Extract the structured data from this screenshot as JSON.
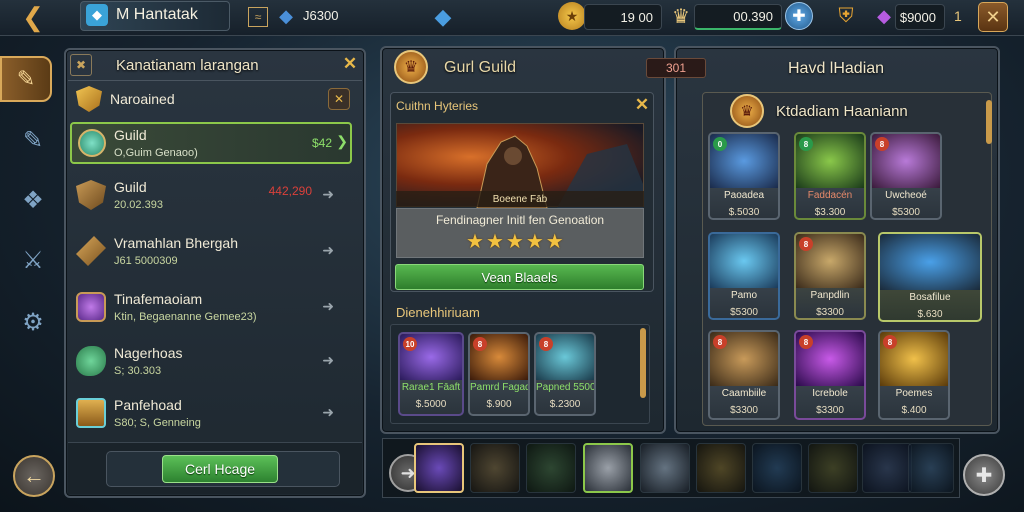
{
  "topbar": {
    "player_name": "M Hantatak",
    "currency1": "J6300",
    "res_gold": "19 00",
    "res_blue": "00.390",
    "res_gems": "$9000",
    "res_gems_suffix": "1"
  },
  "left_panel": {
    "title": "Kanatianam larangan",
    "items": [
      {
        "title": "Naroained",
        "sub": "",
        "value": "",
        "icon": "shield-icon"
      },
      {
        "title": "Guild",
        "sub": "O,Guim Genaoo)",
        "value": "$42",
        "icon": "guild-emblem-icon"
      },
      {
        "title": "Guild",
        "sub": "20.02.393",
        "value": "442,290",
        "icon": "shield-icon"
      },
      {
        "title": "Vramahlan Bhergah",
        "sub": "J61 5000309",
        "value": "",
        "icon": "arrowhead-icon"
      },
      {
        "title": "Tinafemaoiam",
        "sub": "Ktin, Begaenanne Gemee23)",
        "value": "",
        "icon": "crystal-icon"
      },
      {
        "title": "Nagerhoas",
        "sub": "S; 30.303",
        "value": "",
        "icon": "creature-icon"
      },
      {
        "title": "Panfehoad",
        "sub": "S80; S, Genneing",
        "value": "",
        "icon": "chest-icon"
      }
    ],
    "button_label": "Cerl Hcage"
  },
  "mid_panel": {
    "title": "Gurl Guild",
    "sub_panel_title": "Cuithn Hyteries",
    "hero_name": "Boeene Fāb",
    "hero_desc": "Fendinagner Initl fen Genoation",
    "stars": 5,
    "action_label": "Vean Blaaels",
    "section_title": "Dienehhiriuam",
    "mini_cards": [
      {
        "name": "Rarae1 Fāaft",
        "price": "$.5000",
        "badge": "10"
      },
      {
        "name": "Pamrd Fagada",
        "price": "$.900",
        "badge": "8"
      },
      {
        "name": "Papned 5500",
        "price": "$.2300",
        "badge": "8"
      }
    ]
  },
  "right_panel": {
    "counter": "301",
    "title": "Havd lHadian",
    "shop_title": "Ktdadiam Haaniann",
    "cards": [
      {
        "name": "Paoadea",
        "price": "$.5030",
        "badge": "0"
      },
      {
        "name": "Faddacén",
        "price": "$3.300",
        "badge": "8"
      },
      {
        "name": "Uwcheoé",
        "price": "$5300",
        "badge": "8"
      },
      {
        "name": "Pamo",
        "price": "$5300",
        "badge": ""
      },
      {
        "name": "Panpdlin",
        "price": "$3300",
        "badge": "8"
      },
      {
        "name": "Bosafilue",
        "price": "$.630",
        "badge": ""
      },
      {
        "name": "Caambiile",
        "price": "$3300",
        "badge": "8"
      },
      {
        "name": "Icrebole",
        "price": "$3300",
        "badge": "8"
      },
      {
        "name": "Poemes",
        "price": "$.400",
        "badge": "8"
      }
    ]
  },
  "colors": {
    "accent_gold": "#e8c67a",
    "green_button": "#3f9a3a",
    "panel_bg": "#24303a",
    "red_value": "#d9403a"
  }
}
